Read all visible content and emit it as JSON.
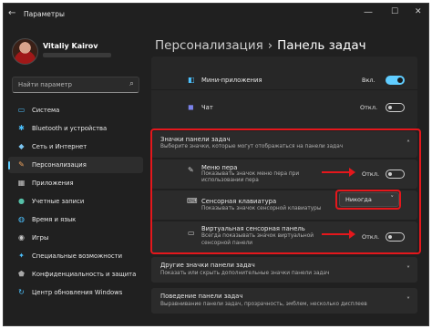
{
  "window": {
    "title": "Параметры",
    "back_glyph": "←",
    "minimize_glyph": "—",
    "maximize_glyph": "☐",
    "close_glyph": "✕"
  },
  "user": {
    "name": "Vitaliy Kairov"
  },
  "search": {
    "placeholder": "Найти параметр",
    "icon": "search-icon",
    "glyph": "⌕"
  },
  "nav": [
    {
      "label": "Система",
      "icon": "monitor-icon",
      "glyph": "▭",
      "color": "#4cc2ff"
    },
    {
      "label": "Bluetooth и устройства",
      "icon": "bluetooth-icon",
      "glyph": "✱",
      "color": "#4cc2ff"
    },
    {
      "label": "Сеть и Интернет",
      "icon": "wifi-icon",
      "glyph": "◆",
      "color": "#7cc5f0"
    },
    {
      "label": "Персонализация",
      "icon": "brush-icon",
      "glyph": "✎",
      "color": "#f0a35e",
      "active": true
    },
    {
      "label": "Приложения",
      "icon": "apps-icon",
      "glyph": "▦",
      "color": "#c8c8c8"
    },
    {
      "label": "Учетные записи",
      "icon": "person-icon",
      "glyph": "●",
      "color": "#56c0a8"
    },
    {
      "label": "Время и язык",
      "icon": "globe-icon",
      "glyph": "◍",
      "color": "#4cc2ff"
    },
    {
      "label": "Игры",
      "icon": "gamepad-icon",
      "glyph": "◉",
      "color": "#c8c8c8"
    },
    {
      "label": "Специальные возможности",
      "icon": "accessibility-icon",
      "glyph": "✦",
      "color": "#4cc2ff"
    },
    {
      "label": "Конфиденциальность и защита",
      "icon": "shield-icon",
      "glyph": "⬟",
      "color": "#a8a8a8"
    },
    {
      "label": "Центр обновления Windows",
      "icon": "update-icon",
      "glyph": "↻",
      "color": "#4cc2ff"
    }
  ],
  "breadcrumb": {
    "parent": "Персонализация",
    "separator": "›",
    "current": "Панель задач"
  },
  "top_items": [
    {
      "label": "Мини-приложения",
      "state": "Вкл.",
      "on": true,
      "icon": "widgets-icon",
      "glyph": "◧",
      "color": "#4cc2ff"
    },
    {
      "label": "Чат",
      "state": "Откл.",
      "on": false,
      "icon": "chat-icon",
      "glyph": "◼",
      "color": "#7b83eb"
    }
  ],
  "tray_icons_section": {
    "title": "Значки панели задач",
    "description": "Выберите значки, которые могут отображаться на панели задач",
    "chevron": "˄",
    "items": [
      {
        "label": "Меню пера",
        "desc_1": "Показывать значок меню пера при",
        "desc_2": "использовании пера",
        "state": "Откл.",
        "on": false,
        "icon": "pen-icon",
        "glyph": "✎"
      },
      {
        "label": "Сенсорная клавиатура",
        "desc_1": "Показывать значок сенсорной клавиатуры",
        "desc_2": "",
        "dropdown_value": "Никогда",
        "dropdown_chevron": "˅",
        "icon": "keyboard-icon",
        "glyph": "⌨"
      },
      {
        "label": "Виртуальная сенсорная панель",
        "desc_1": "Всегда показывать значок виртуальной",
        "desc_2": "сенсорной панели",
        "state": "Откл.",
        "on": false,
        "icon": "touchpad-icon",
        "glyph": "▭"
      }
    ]
  },
  "other_sections": [
    {
      "title": "Другие значки панели задач",
      "desc": "Показать или скрыть дополнительные значки панели задач",
      "chevron": "˅"
    },
    {
      "title": "Поведение панели задач",
      "desc": "Выравнивание панели задач, прозрачность, эмблем, несколько дисплеев",
      "chevron": "˅"
    }
  ],
  "annotation_color": "#e5171c"
}
